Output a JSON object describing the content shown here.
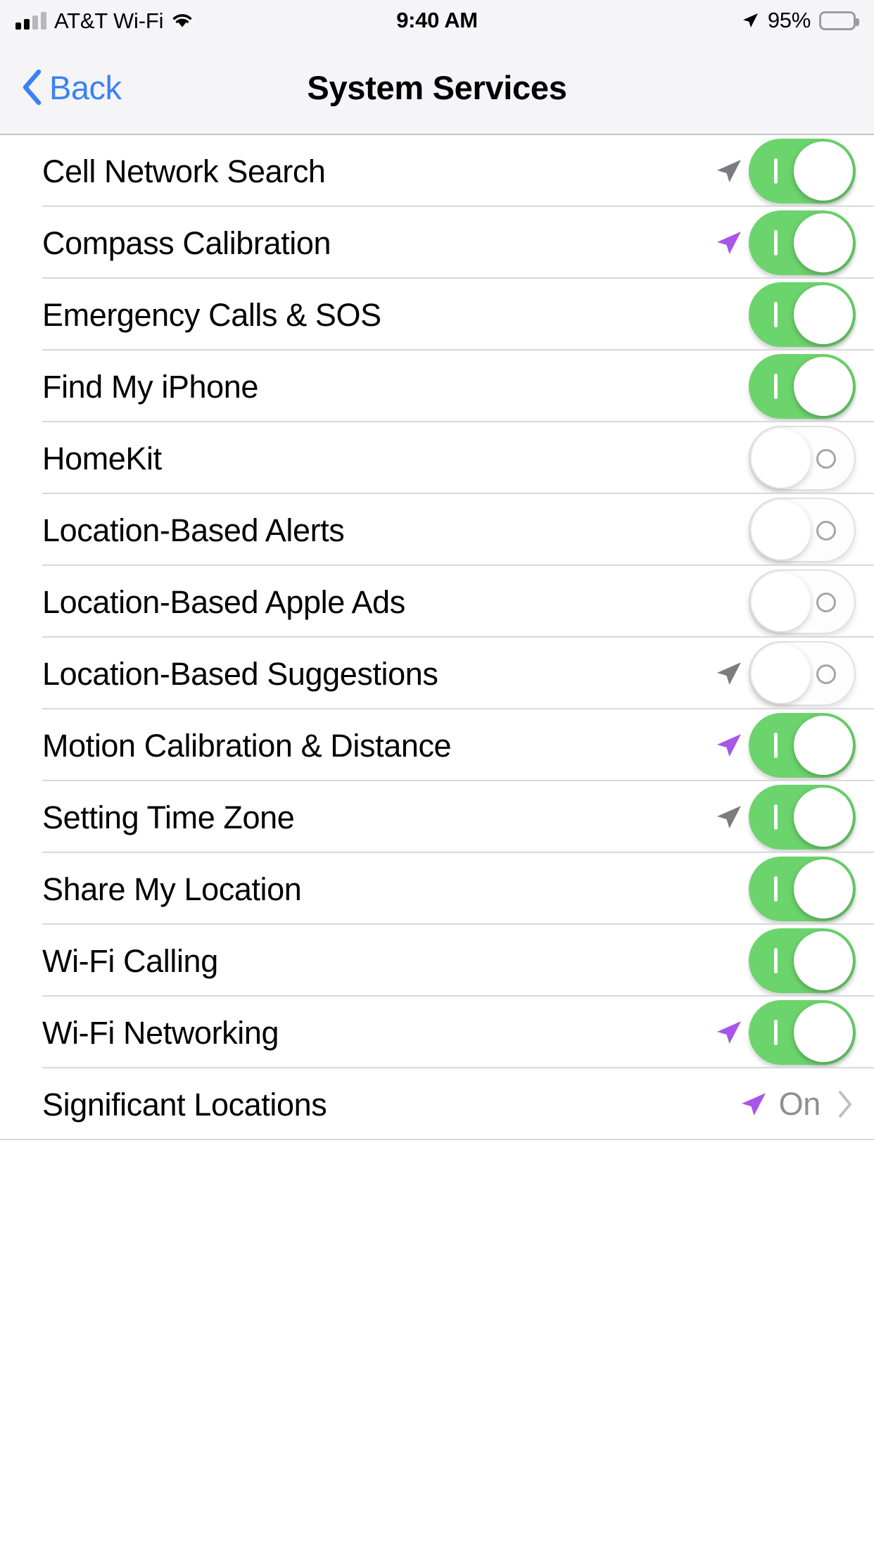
{
  "status_bar": {
    "signal_icon": "cellular-signal-icon",
    "signal_bars_total": 4,
    "signal_bars_filled": 2,
    "carrier": "AT&T Wi-Fi",
    "wifi_icon": "wifi-icon",
    "time": "9:40 AM",
    "location_icon": "location-arrow-icon",
    "battery_percent": "95%",
    "battery_level": 95,
    "battery_icon": "battery-icon"
  },
  "nav_bar": {
    "back_icon": "chevron-left-icon",
    "back_label": "Back",
    "title": "System Services"
  },
  "colors": {
    "switch_on": "#6cd46c",
    "switch_off_track": "#fdfdfd",
    "tint_blue": "#3a82f6",
    "arrow_purple": "#a855e8",
    "arrow_gray": "#7b7b80",
    "detail_gray": "#8e8e93",
    "separator": "#d8d8da",
    "bar_background": "#f5f5f7"
  },
  "list": {
    "rows": [
      {
        "label": "Cell Network Search",
        "type": "switch",
        "value": "on",
        "arrow": "gray"
      },
      {
        "label": "Compass Calibration",
        "type": "switch",
        "value": "on",
        "arrow": "purple"
      },
      {
        "label": "Emergency Calls & SOS",
        "type": "switch",
        "value": "on",
        "arrow": "none"
      },
      {
        "label": "Find My iPhone",
        "type": "switch",
        "value": "on",
        "arrow": "none"
      },
      {
        "label": "HomeKit",
        "type": "switch",
        "value": "off",
        "arrow": "none"
      },
      {
        "label": "Location-Based Alerts",
        "type": "switch",
        "value": "off",
        "arrow": "none"
      },
      {
        "label": "Location-Based Apple Ads",
        "type": "switch",
        "value": "off",
        "arrow": "none"
      },
      {
        "label": "Location-Based Suggestions",
        "type": "switch",
        "value": "off",
        "arrow": "gray"
      },
      {
        "label": "Motion Calibration & Distance",
        "type": "switch",
        "value": "on",
        "arrow": "purple"
      },
      {
        "label": "Setting Time Zone",
        "type": "switch",
        "value": "on",
        "arrow": "gray"
      },
      {
        "label": "Share My Location",
        "type": "switch",
        "value": "on",
        "arrow": "none"
      },
      {
        "label": "Wi-Fi Calling",
        "type": "switch",
        "value": "on",
        "arrow": "none"
      },
      {
        "label": "Wi-Fi Networking",
        "type": "switch",
        "value": "on",
        "arrow": "purple"
      },
      {
        "label": "Significant Locations",
        "type": "detail",
        "value": "On",
        "arrow": "purple",
        "chevron_icon": "chevron-right-icon"
      }
    ]
  }
}
